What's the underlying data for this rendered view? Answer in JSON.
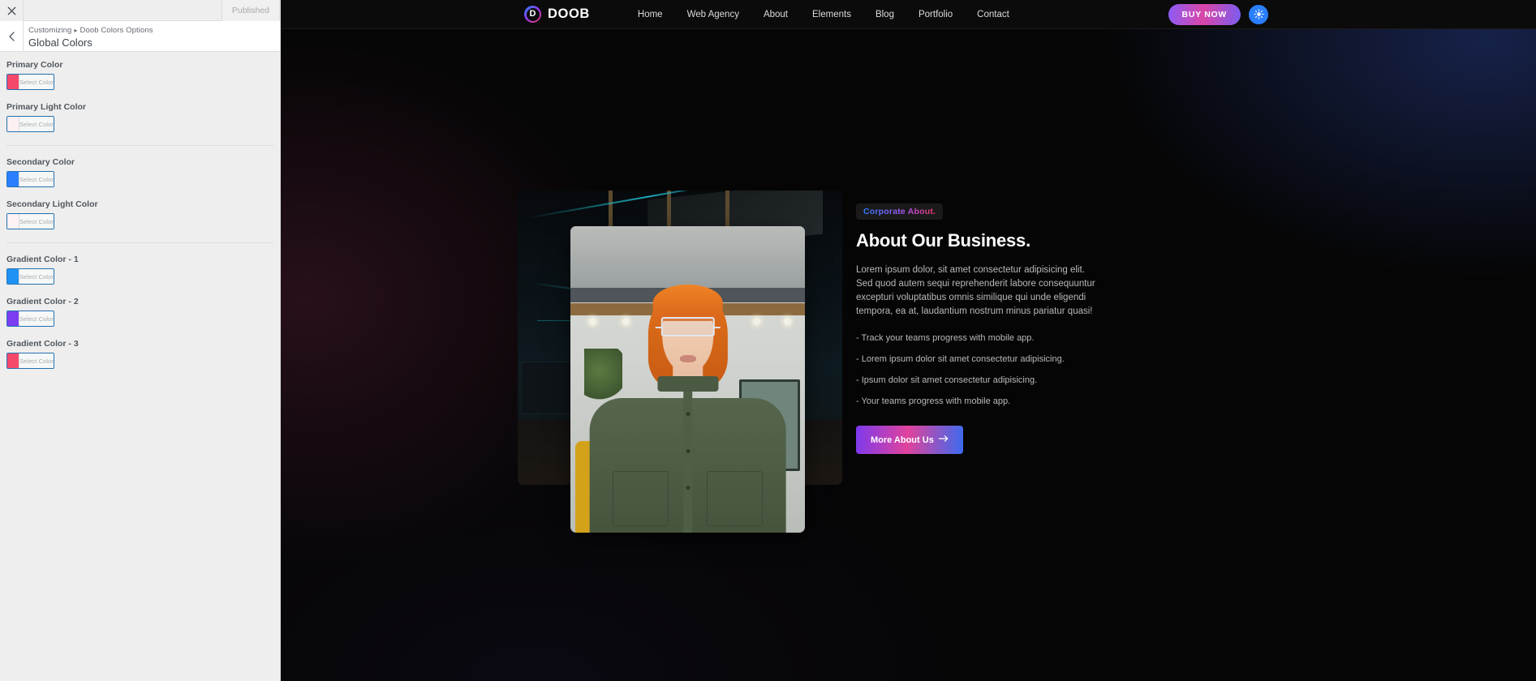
{
  "customizer": {
    "close_icon": "close-icon",
    "published_label": "Published",
    "back_icon": "chevron-left-icon",
    "breadcrumb_root": "Customizing",
    "breadcrumb_sep": "▸",
    "breadcrumb_section": "Doob Colors Options",
    "page_title": "Global Colors",
    "select_color_label": "Select Color",
    "groups": [
      {
        "fields": [
          {
            "label": "Primary Color",
            "swatch": "#f4496b",
            "button": "Select Color"
          },
          {
            "label": "Primary Light Color",
            "swatch": "#fdf0f3",
            "button": "Select Color"
          }
        ]
      },
      {
        "fields": [
          {
            "label": "Secondary Color",
            "swatch": "#2b7fff",
            "button": "Select Color"
          },
          {
            "label": "Secondary Light Color",
            "swatch": "#fdf2f4",
            "button": "Select Color"
          }
        ]
      },
      {
        "fields": [
          {
            "label": "Gradient Color - 1",
            "swatch": "#1f93f5",
            "button": "Select Color"
          },
          {
            "label": "Gradient Color - 2",
            "swatch": "#7b3ef0",
            "button": "Select Color"
          },
          {
            "label": "Gradient Color - 3",
            "swatch": "#f4496b",
            "button": "Select Color"
          }
        ]
      }
    ]
  },
  "site": {
    "brand": {
      "initial": "D",
      "name": "DOOB"
    },
    "nav": [
      {
        "label": "Home"
      },
      {
        "label": "Web Agency"
      },
      {
        "label": "About"
      },
      {
        "label": "Elements"
      },
      {
        "label": "Blog"
      },
      {
        "label": "Portfolio"
      },
      {
        "label": "Contact"
      }
    ],
    "buy_now_label": "BUY NOW",
    "theme_toggle_icon": "sun-icon",
    "about": {
      "badge": "Corporate About.",
      "title": "About Our Business.",
      "paragraph": "Lorem ipsum dolor, sit amet consectetur adipisicing elit. Sed quod autem sequi reprehenderit labore consequuntur excepturi voluptatibus omnis similique qui unde eligendi tempora, ea at, laudantium nostrum minus pariatur quasi!",
      "list": [
        "- Track your teams progress with mobile app.",
        "- Lorem ipsum dolor sit amet consectetur adipisicing.",
        "- Ipsum dolor sit amet consectetur adipisicing.",
        "- Your teams progress with mobile app."
      ],
      "cta_label": "More About Us",
      "cta_icon": "arrow-right-icon",
      "back_image_alt": "dark office interior",
      "front_image_alt": "woman with glasses portrait"
    }
  },
  "colors": {
    "primary": "#f4496b",
    "secondary": "#2b7fff",
    "gradient_1": "#1f93f5",
    "gradient_2": "#7b3ef0",
    "gradient_3": "#f4496b",
    "site_background": "#050505"
  }
}
